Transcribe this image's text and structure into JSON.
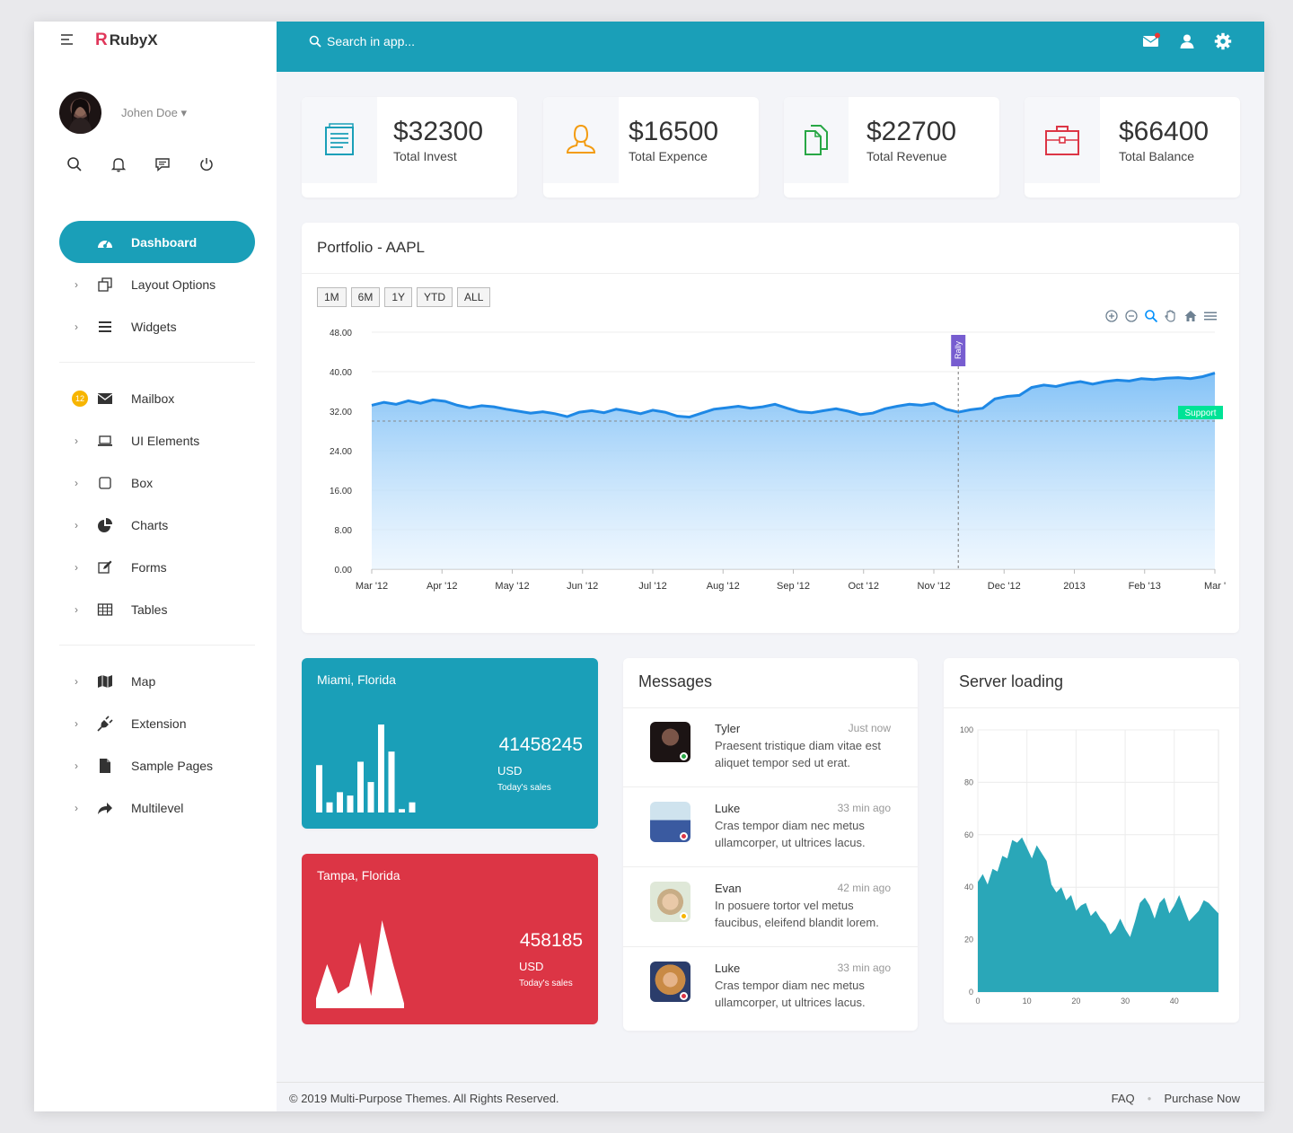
{
  "app": {
    "logo_letter": "R",
    "name": "RubyX"
  },
  "user": {
    "name": "Johen Doe ▾"
  },
  "search": {
    "placeholder": "Search in app..."
  },
  "menu": {
    "group1": [
      {
        "label": "Dashboard",
        "icon": "dashboard-icon",
        "active": true
      },
      {
        "label": "Layout Options",
        "icon": "layout-icon"
      },
      {
        "label": "Widgets",
        "icon": "list-icon"
      }
    ],
    "group2": [
      {
        "label": "Mailbox",
        "icon": "mail-icon",
        "badge": "12"
      },
      {
        "label": "UI Elements",
        "icon": "laptop-icon"
      },
      {
        "label": "Box",
        "icon": "square-icon"
      },
      {
        "label": "Charts",
        "icon": "pie-chart-icon"
      },
      {
        "label": "Forms",
        "icon": "edit-icon"
      },
      {
        "label": "Tables",
        "icon": "table-icon"
      }
    ],
    "group3": [
      {
        "label": "Map",
        "icon": "map-icon"
      },
      {
        "label": "Extension",
        "icon": "plug-icon"
      },
      {
        "label": "Sample Pages",
        "icon": "file-icon"
      },
      {
        "label": "Multilevel",
        "icon": "share-icon"
      }
    ]
  },
  "stats": [
    {
      "value": "$32300",
      "label": "Total Invest",
      "color": "#1a9fb8"
    },
    {
      "value": "$16500",
      "label": "Total Expence",
      "color": "#f39c12"
    },
    {
      "value": "$22700",
      "label": "Total Revenue",
      "color": "#28a745"
    },
    {
      "value": "$66400",
      "label": "Total Balance",
      "color": "#dc3545"
    }
  ],
  "portfolio": {
    "title": "Portfolio - AAPL",
    "ranges": [
      "1M",
      "6M",
      "1Y",
      "YTD",
      "ALL"
    ]
  },
  "chart_data": [
    {
      "type": "area",
      "title": "Portfolio - AAPL",
      "x_ticks": [
        "Mar '12",
        "Apr '12",
        "May '12",
        "Jun '12",
        "Jul '12",
        "Aug '12",
        "Sep '12",
        "Oct '12",
        "Nov '12",
        "Dec '12",
        "2013",
        "Feb '13",
        "Mar '"
      ],
      "y_ticks": [
        "48.00",
        "40.00",
        "32.00",
        "24.00",
        "16.00",
        "8.00",
        "0.00"
      ],
      "ylim": [
        0,
        48
      ],
      "values": [
        33.2,
        33.8,
        33.4,
        34.1,
        33.6,
        34.3,
        34.0,
        33.2,
        32.7,
        33.1,
        32.9,
        32.4,
        32.0,
        31.6,
        31.9,
        31.5,
        30.9,
        31.8,
        32.1,
        31.7,
        32.4,
        32.0,
        31.5,
        32.2,
        31.8,
        31.0,
        30.8,
        31.6,
        32.4,
        32.7,
        33.0,
        32.6,
        32.9,
        33.4,
        32.6,
        31.9,
        31.7,
        32.1,
        32.5,
        32.0,
        31.3,
        31.6,
        32.5,
        33.0,
        33.4,
        33.2,
        33.6,
        32.4,
        31.8,
        32.3,
        32.6,
        34.5,
        35.0,
        35.2,
        36.8,
        37.3,
        37.0,
        37.6,
        38.0,
        37.5,
        38.0,
        38.3,
        38.1,
        38.6,
        38.4,
        38.7,
        38.8,
        38.6,
        39.0,
        39.7
      ],
      "annotations": {
        "vertical": {
          "label": "Rally",
          "x_index": 48
        },
        "horizontal": {
          "label": "Support",
          "y": 30
        }
      },
      "colors": {
        "fill": "#8ec8f8",
        "line": "#1e88e5"
      }
    },
    {
      "type": "bar",
      "title": "Miami, Florida",
      "values": [
        14,
        3,
        6,
        5,
        15,
        9,
        26,
        18,
        1,
        3
      ],
      "color": "#ffffff"
    },
    {
      "type": "area",
      "title": "Tampa, Florida",
      "values": [
        4,
        18,
        6,
        9,
        27,
        5,
        36,
        18,
        2
      ],
      "color": "#ffffff"
    },
    {
      "type": "area",
      "title": "Server loading",
      "x_ticks": [
        "0",
        "10",
        "20",
        "30",
        "40"
      ],
      "y_ticks": [
        "100",
        "80",
        "60",
        "40",
        "20",
        "0"
      ],
      "xlim": [
        0,
        49
      ],
      "ylim": [
        0,
        100
      ],
      "values": [
        42,
        45,
        41,
        47,
        46,
        52,
        51,
        58,
        57,
        59,
        55,
        51,
        56,
        53,
        50,
        41,
        38,
        40,
        35,
        37,
        31,
        33,
        34,
        29,
        31,
        28,
        26,
        22,
        24,
        28,
        24,
        21,
        27,
        34,
        36,
        33,
        28,
        34,
        36,
        30,
        33,
        37,
        32,
        27,
        29,
        31,
        35,
        34,
        32,
        30
      ],
      "color": "#2aa7b8",
      "grid": true
    }
  ],
  "weather": [
    {
      "city": "Miami, Florida",
      "value": "41458245",
      "unit": "USD",
      "sub": "Today's sales",
      "color": "#1a9fb8"
    },
    {
      "city": "Tampa, Florida",
      "value": "458185",
      "unit": "USD",
      "sub": "Today's sales",
      "color": "#dc3545"
    }
  ],
  "messages": {
    "title": "Messages",
    "items": [
      {
        "name": "Tyler",
        "time": "Just now",
        "text": "Praesent tristique diam vitae est aliquet tempor sed ut erat.",
        "status_color": "#28a745"
      },
      {
        "name": "Luke",
        "time": "33 min ago",
        "text": "Cras tempor diam nec metus ullamcorper, ut ultrices lacus.",
        "status_color": "#dc3545"
      },
      {
        "name": "Evan",
        "time": "42 min ago",
        "text": "In posuere tortor vel metus faucibus, eleifend blandit lorem.",
        "status_color": "#f7b500"
      },
      {
        "name": "Luke",
        "time": "33 min ago",
        "text": "Cras tempor diam nec metus ullamcorper, ut ultrices lacus.",
        "status_color": "#dc3545"
      }
    ]
  },
  "server": {
    "title": "Server loading"
  },
  "footer": {
    "copyright": "© 2019 Multi-Purpose Themes. All Rights Reserved.",
    "faq": "FAQ",
    "purchase": "Purchase Now"
  }
}
